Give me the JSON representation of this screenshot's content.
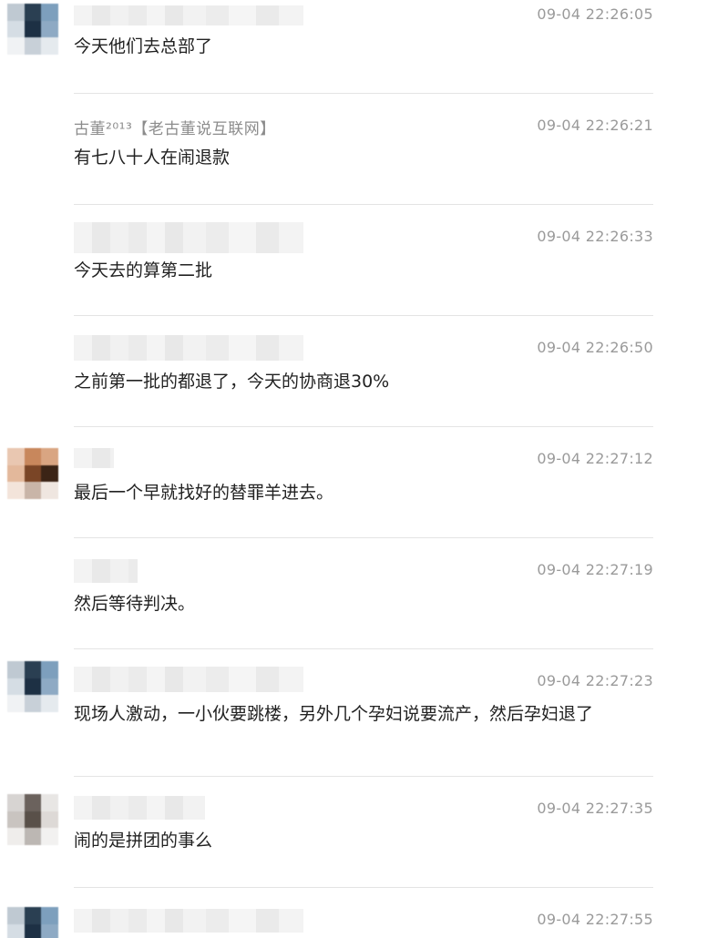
{
  "messages": [
    {
      "sender": "",
      "time": "09-04 22:26:05",
      "text": "今天他们去总部了"
    },
    {
      "sender": "古董²⁰¹³【老古董说互联网】",
      "time": "09-04 22:26:21",
      "text": "有七八十人在闹退款"
    },
    {
      "sender": "",
      "time": "09-04 22:26:33",
      "text": "今天去的算第二批"
    },
    {
      "sender": "",
      "time": "09-04 22:26:50",
      "text": "之前第一批的都退了，今天的协商退30%"
    },
    {
      "sender": "",
      "time": "09-04 22:27:12",
      "text": "最后一个早就找好的替罪羊进去。"
    },
    {
      "sender": "",
      "time": "09-04 22:27:19",
      "text": "然后等待判决。"
    },
    {
      "sender": "",
      "time": "09-04 22:27:23",
      "text": "现场人激动，一小伙要跳楼，另外几个孕妇说要流产，然后孕妇退了"
    },
    {
      "sender": "",
      "time": "09-04 22:27:35",
      "text": "闹的是拼团的事么"
    },
    {
      "sender": "",
      "time": "09-04 22:27:55",
      "text": ""
    }
  ]
}
